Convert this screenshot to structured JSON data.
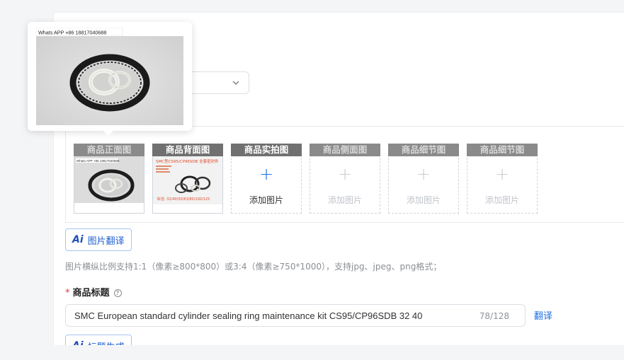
{
  "image_slots": [
    {
      "label": "商品正面图",
      "state": "filled",
      "caption": "Whats APP +86 18817040688"
    },
    {
      "label": "商品背面图",
      "state": "filled",
      "caption": "SMC型CS95/CP96SDB 全套密封件",
      "sizes": "缸径: 32/40/50/63/80/100/125"
    },
    {
      "label": "商品实拍图",
      "state": "add",
      "add_label": "添加图片"
    },
    {
      "label": "商品侧面图",
      "state": "add-disabled",
      "add_label": "添加图片"
    },
    {
      "label": "商品细节图",
      "state": "add-disabled",
      "add_label": "添加图片"
    },
    {
      "label": "商品细节图",
      "state": "add-disabled",
      "add_label": "添加图片"
    }
  ],
  "popover": {
    "caption": "Whats APP +86 18817040688"
  },
  "image_translate_button": {
    "icon": "Ai",
    "label": "图片翻译"
  },
  "image_hint": "图片横纵比例支持1:1（像素≥800*800）或3:4（像素≥750*1000），支持jpg、jpeg、png格式；",
  "title_field": {
    "required_mark": "*",
    "label": "商品标题",
    "help_icon": "?",
    "value": "SMC European standard cylinder sealing ring maintenance kit CS95/CP96SDB 32 40",
    "counter": "78/128",
    "translate_label": "翻译"
  },
  "title_generate_button": {
    "icon": "Ai",
    "label": "标题生成"
  },
  "colors": {
    "accent": "#1f6fe5",
    "slot_header": "#707070",
    "required": "#e0393e"
  }
}
